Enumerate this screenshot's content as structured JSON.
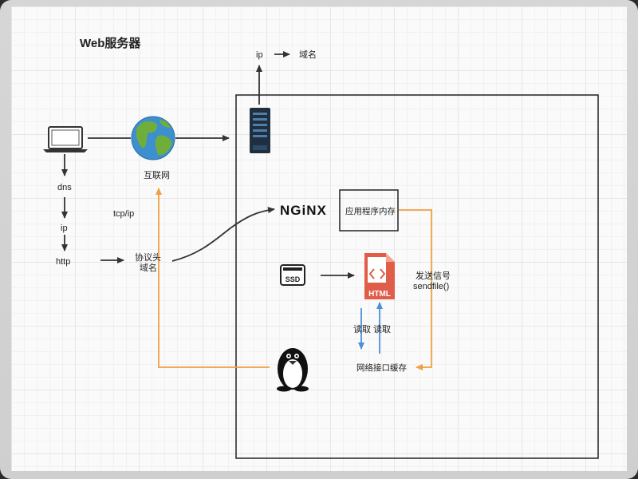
{
  "title": "Web服务器",
  "labels": {
    "ip_top": "ip",
    "domain_top": "域名",
    "internet": "互联网",
    "dns": "dns",
    "ip_left": "ip",
    "http": "http",
    "tcp_ip": "tcp/ip",
    "protocol_head": "协议头",
    "domain_mid": "域名",
    "nginx": "NGiNX",
    "app_memory": "应用程序内存",
    "send_signal": "发送信号",
    "sendfile": "sendfile()",
    "ssd": "SSD",
    "html": "HTML",
    "read_1": "读取",
    "read_2": "读取",
    "nic_buffer": "网络接口缓存"
  },
  "colors": {
    "arrow": "#333333",
    "orange": "#f0a040",
    "blue": "#4a90d9",
    "html_red": "#e05d4a"
  }
}
